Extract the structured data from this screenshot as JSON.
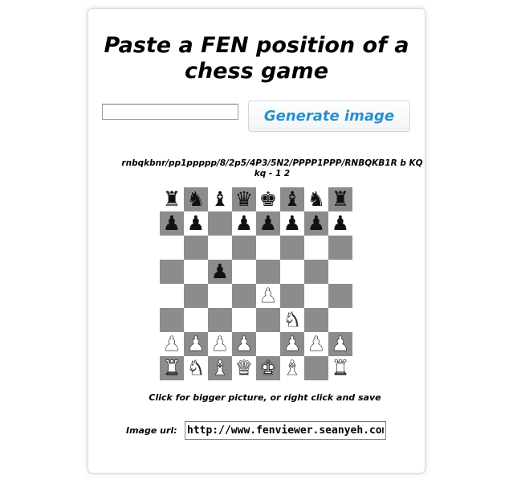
{
  "title": "Paste a FEN position of a chess game",
  "fen_input": {
    "value": "",
    "placeholder": ""
  },
  "generate_button": {
    "label": "Generate image"
  },
  "fen_display": "rnbqkbnr/pp1ppppp/8/2p5/4P3/5N2/PPPP1PPP/RNBQKB1R b KQkq - 1 2",
  "board": {
    "ranks": [
      [
        "r",
        "n",
        "b",
        "q",
        "k",
        "b",
        "n",
        "r"
      ],
      [
        "p",
        "p",
        "",
        "p",
        "p",
        "p",
        "p",
        "p"
      ],
      [
        "",
        "",
        "",
        "",
        "",
        "",
        "",
        ""
      ],
      [
        "",
        "",
        "p",
        "",
        "",
        "",
        "",
        ""
      ],
      [
        "",
        "",
        "",
        "",
        "P",
        "",
        "",
        ""
      ],
      [
        "",
        "",
        "",
        "",
        "",
        "N",
        "",
        ""
      ],
      [
        "P",
        "P",
        "P",
        "P",
        "",
        "P",
        "P",
        "P"
      ],
      [
        "R",
        "N",
        "B",
        "Q",
        "K",
        "B",
        "",
        "R"
      ]
    ],
    "light_color": "#ffffff",
    "dark_color": "#8c8c8c"
  },
  "caption": "Click for bigger picture, or right click and save",
  "image_url": {
    "label": "Image url:",
    "value": "http://www.fenviewer.seanyeh.com/"
  },
  "colors": {
    "accent": "#2a8fc9",
    "card_border": "#d6dde3"
  }
}
